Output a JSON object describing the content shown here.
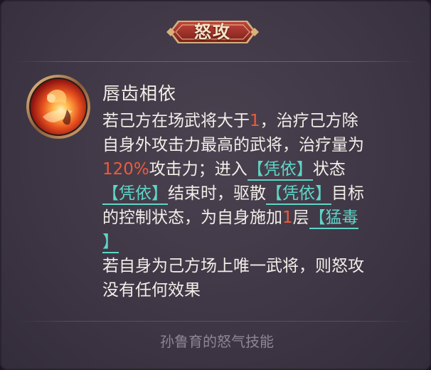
{
  "banner": {
    "title": "怒攻"
  },
  "skill": {
    "icon": "flame-skill-portrait-icon",
    "name": "唇齿相依",
    "lines": [
      [
        {
          "t": "若己方在场武将大于"
        },
        {
          "t": "1",
          "s": "num"
        },
        {
          "t": "，治疗己方除"
        }
      ],
      [
        {
          "t": "自身外攻击力最高的武将，治疗量为"
        }
      ],
      [
        {
          "t": "120%",
          "s": "num"
        },
        {
          "t": "攻击力；进入"
        },
        {
          "t": "【凭依】",
          "s": "kw"
        },
        {
          "t": "状态"
        }
      ],
      [
        {
          "t": "【凭依】",
          "s": "kw"
        },
        {
          "t": "结束时，驱散"
        },
        {
          "t": "【凭依】",
          "s": "kw"
        },
        {
          "t": "目标"
        }
      ],
      [
        {
          "t": "的控制状态，为自身施加"
        },
        {
          "t": "1",
          "s": "num"
        },
        {
          "t": "层"
        },
        {
          "t": "【猛毒",
          "s": "kw"
        }
      ],
      [
        {
          "t": "】",
          "s": "kw"
        }
      ],
      [
        {
          "t": "若自身为己方场上唯一武将，则怒攻"
        }
      ],
      [
        {
          "t": "没有任何效果"
        }
      ]
    ]
  },
  "footer": {
    "text": "孙鲁育的怒气技能"
  },
  "colors": {
    "highlight_number": "#ef5a3a",
    "keyword": "#5ed6c8",
    "banner_red": "#a8322a",
    "banner_gold": "#d9b27a"
  }
}
